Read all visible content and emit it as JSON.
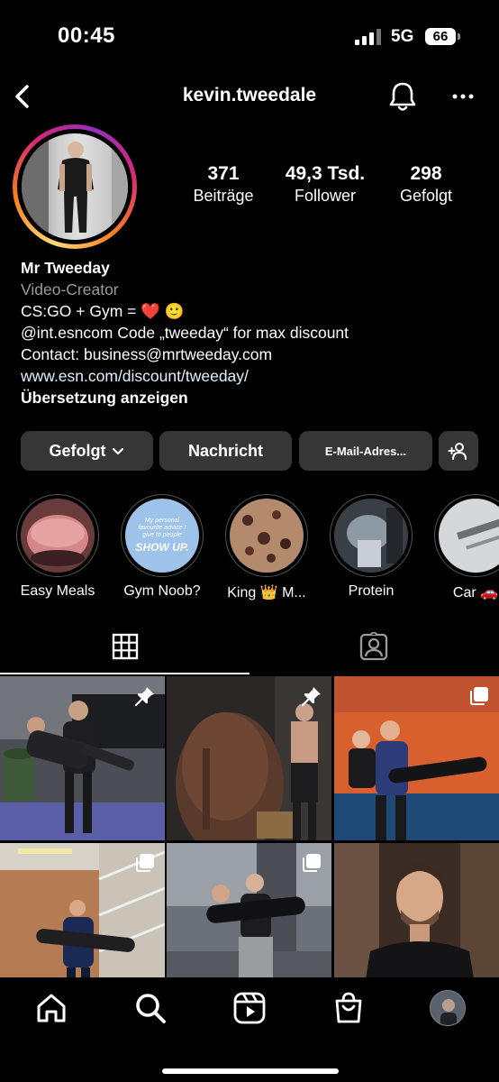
{
  "status": {
    "time": "00:45",
    "network": "5G",
    "battery": "66"
  },
  "header": {
    "username": "kevin.tweedale",
    "icons": [
      "back-icon",
      "bell-icon",
      "more-icon"
    ]
  },
  "stats": {
    "posts": {
      "value": "371",
      "label": "Beiträge"
    },
    "followers": {
      "value": "49,3 Tsd.",
      "label": "Follower"
    },
    "following": {
      "value": "298",
      "label": "Gefolgt"
    }
  },
  "bio": {
    "name": "Mr Tweeday",
    "category": "Video-Creator",
    "line1": "CS:GO + Gym = ❤️ 🙂",
    "line2": "@int.esncom Code „tweeday“ for max discount",
    "line3": "Contact: business@mrtweeday.com",
    "link": "www.esn.com/discount/tweeday/",
    "translate": "Übersetzung anzeigen"
  },
  "buttons": {
    "follow": "Gefolgt",
    "message": "Nachricht",
    "email": "E-Mail-Adres..."
  },
  "highlights": [
    {
      "label": "Easy Meals"
    },
    {
      "label": "Gym Noob?",
      "text_top": "My personal favourite advice I give to people",
      "text_big": "SHOW UP."
    },
    {
      "label": "King 👑 M..."
    },
    {
      "label": "Protein"
    },
    {
      "label": "Car 🚗"
    }
  ],
  "tabs": [
    "grid-icon",
    "tagged-icon"
  ],
  "grid": [
    {
      "badge": "pin-icon"
    },
    {
      "badge": "pin-icon"
    },
    {
      "badge": "multi-photo-icon"
    },
    {
      "badge": "multi-photo-icon"
    },
    {
      "badge": "multi-photo-icon"
    },
    {
      "badge": ""
    }
  ],
  "nav": [
    "home-icon",
    "search-icon",
    "reels-icon",
    "shop-icon",
    "profile-avatar"
  ],
  "colors": {
    "background": "#000000",
    "button": "#363636",
    "secondary_text": "#9b9b9b",
    "link": "#e0f1ff"
  }
}
